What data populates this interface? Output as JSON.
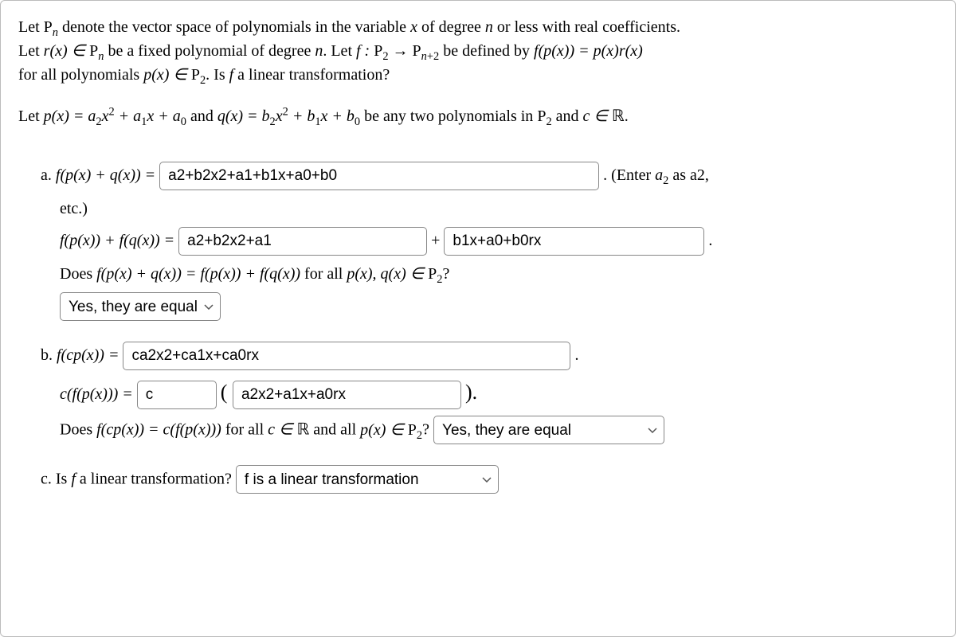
{
  "intro": {
    "line1_pre": "Let ",
    "Pn": "P",
    "line1_post": " denote the vector space of polynomials in the variable ",
    "var_x": "x",
    "line1_post2": " of degree ",
    "var_n": "n",
    "line1_post3": " or less with real coefficients.",
    "line2_pre": "Let ",
    "rx": "r(x) ∈ ",
    "line2_post": " be a fixed polynomial of degree ",
    "line2_post2": ". Let ",
    "fdef": "f : ",
    "P2": "P",
    "arrow": " → ",
    "Pnp2": "P",
    "line2_post3": " be defined by ",
    "fpx": "f(p(x)) = p(x)r(x)",
    "line3_pre": "for all polynomials ",
    "pinP2": "p(x) ∈ ",
    "line3_post": ". Is ",
    "f": "f",
    "line3_post2": " a linear transformation?"
  },
  "setup": {
    "pre": "Let ",
    "pdef": "p(x) = a",
    "pdef2": "x",
    "pdef3": " + a",
    "pdef4": "x + a",
    "mid": " and ",
    "qdef": "q(x) = b",
    "qdef2": "x",
    "qdef3": " + b",
    "qdef4": "x + b",
    "post": " be any two polynomials in ",
    "post2": " and ",
    "cinR": "c ∈ ",
    "R": "ℝ",
    "period": "."
  },
  "partA": {
    "label": "a. ",
    "fpq": "f(p(x) + q(x)) = ",
    "input1": "a2+b2x2+a1+b1x+a0+b0",
    "hint": " . (Enter ",
    "a2math": "a",
    "hint2": " as a2,",
    "etc": "etc.)",
    "fpfq": "f(p(x)) + f(q(x)) = ",
    "input2a": "a2+b2x2+a1",
    "plus": " + ",
    "input2b": "b1x+a0+b0rx",
    "period": " .",
    "does": "Does ",
    "eqline": "f(p(x) + q(x)) = f(p(x)) + f(q(x))",
    "forall": " for all ",
    "pxqx": "p(x), q(x) ∈ ",
    "qmark": "?",
    "select": "Yes, they are equal"
  },
  "partB": {
    "label": "b. ",
    "fcp": "f(cp(x)) = ",
    "input1": "ca2x2+ca1x+ca0rx",
    "period1": " .",
    "cfp": "c(f(p(x))) = ",
    "input2": "c",
    "lparen": " ( ",
    "input3": "a2x2+a1x+a0rx",
    "rparen": " ).",
    "does": "Does ",
    "eqline": "f(cp(x)) = c(f(p(x)))",
    "forall": " for all ",
    "cinR": "c ∈ ",
    "R": "ℝ",
    "andall": " and all ",
    "pinP2": "p(x) ∈ ",
    "qmark": "? ",
    "select": "Yes, they are equal"
  },
  "partC": {
    "label": "c. Is ",
    "f": "f",
    "post": " a linear transformation? ",
    "select": "f is a linear transformation"
  }
}
